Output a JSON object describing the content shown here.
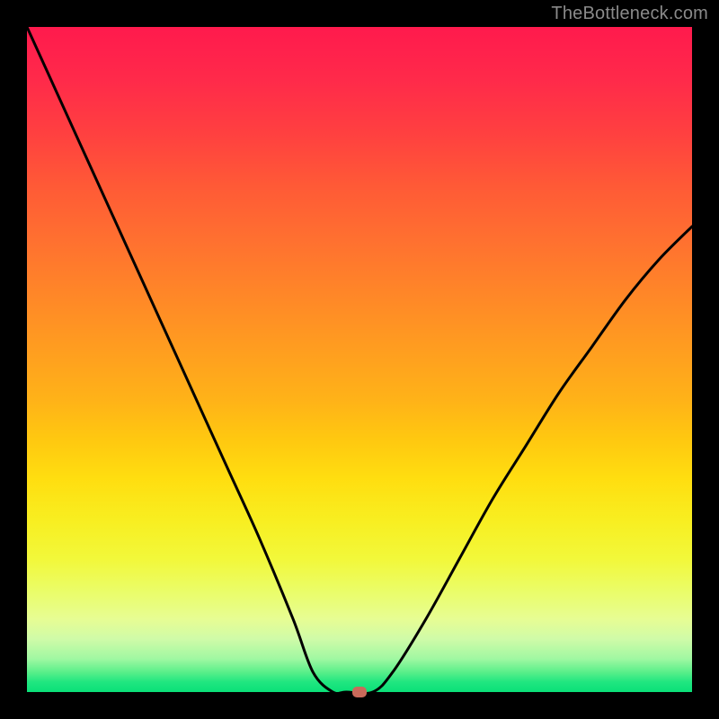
{
  "watermark": "TheBottleneck.com",
  "chart_data": {
    "type": "line",
    "title": "",
    "xlabel": "",
    "ylabel": "",
    "xlim": [
      0,
      100
    ],
    "ylim": [
      0,
      100
    ],
    "grid": false,
    "legend": false,
    "series": [
      {
        "name": "bottleneck-curve",
        "x": [
          0,
          5,
          10,
          15,
          20,
          25,
          30,
          35,
          40,
          43,
          46,
          48,
          52,
          55,
          60,
          65,
          70,
          75,
          80,
          85,
          90,
          95,
          100
        ],
        "y": [
          100,
          89,
          78,
          67,
          56,
          45,
          34,
          23,
          11,
          3,
          0,
          0,
          0,
          3,
          11,
          20,
          29,
          37,
          45,
          52,
          59,
          65,
          70
        ]
      }
    ],
    "marker": {
      "x": 50,
      "y": 0,
      "color": "#c96a5a"
    },
    "gradient_stops": [
      {
        "pct": 0,
        "color": "#ff1a4d"
      },
      {
        "pct": 50,
        "color": "#ffb218"
      },
      {
        "pct": 80,
        "color": "#f2f83a"
      },
      {
        "pct": 100,
        "color": "#0ae078"
      }
    ]
  }
}
